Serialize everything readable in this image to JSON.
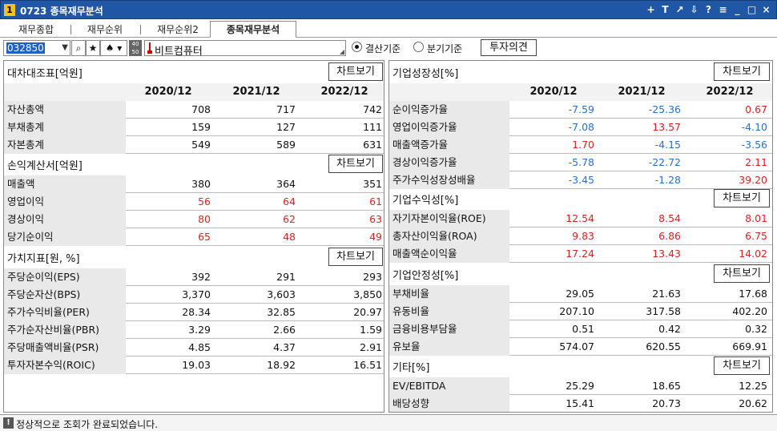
{
  "window": {
    "number": "1",
    "title": "0723 종목재무분석",
    "controls": [
      "+",
      "T",
      "↗",
      "⇩",
      "?",
      "≡",
      "_",
      "□",
      "×"
    ]
  },
  "tabs": [
    "재무종합",
    "재무순위",
    "재무순위2",
    "종목재무분석"
  ],
  "toolbar": {
    "code": "032850",
    "tool_label_top": "40",
    "tool_label_bottom": "50",
    "stock_name": "비트컴퓨터",
    "radio1": "결산기준",
    "radio2": "분기기준",
    "opinion_button": "투자의견"
  },
  "chart_button": "차트보기",
  "years": [
    "2020/12",
    "2021/12",
    "2022/12"
  ],
  "left": {
    "balance": {
      "title": "대차대조표[억원]",
      "rows": [
        {
          "label": "자산총액",
          "values": [
            "708",
            "717",
            "742"
          ],
          "color": "black"
        },
        {
          "label": "부채총계",
          "values": [
            "159",
            "127",
            "111"
          ],
          "color": "black"
        },
        {
          "label": "자본총계",
          "values": [
            "549",
            "589",
            "631"
          ],
          "color": "black"
        }
      ]
    },
    "income": {
      "title": "손익계산서[억원]",
      "rows": [
        {
          "label": "매출액",
          "values": [
            "380",
            "364",
            "351"
          ],
          "color": "black"
        },
        {
          "label": "영업이익",
          "values": [
            "56",
            "64",
            "61"
          ],
          "color": "red"
        },
        {
          "label": "경상이익",
          "values": [
            "80",
            "62",
            "63"
          ],
          "color": "red"
        },
        {
          "label": "당기순이익",
          "values": [
            "65",
            "48",
            "49"
          ],
          "color": "red"
        }
      ]
    },
    "value": {
      "title": "가치지표[원, %]",
      "rows": [
        {
          "label": "주당순이익(EPS)",
          "values": [
            "392",
            "291",
            "293"
          ],
          "color": "black"
        },
        {
          "label": "주당순자산(BPS)",
          "values": [
            "3,370",
            "3,603",
            "3,850"
          ],
          "color": "black"
        },
        {
          "label": "주가수익비율(PER)",
          "values": [
            "28.34",
            "32.85",
            "20.97"
          ],
          "color": "black"
        },
        {
          "label": "주가순자산비율(PBR)",
          "values": [
            "3.29",
            "2.66",
            "1.59"
          ],
          "color": "black"
        },
        {
          "label": "주당매출액비율(PSR)",
          "values": [
            "4.85",
            "4.37",
            "2.91"
          ],
          "color": "black"
        },
        {
          "label": "투자자본수익(ROIC)",
          "values": [
            "19.03",
            "18.92",
            "16.51"
          ],
          "color": "black"
        }
      ]
    }
  },
  "right": {
    "growth": {
      "title": "기업성장성[%]",
      "rows": [
        {
          "label": "순이익증가율",
          "values": [
            "-7.59",
            "-25.36",
            "0.67"
          ],
          "colors": [
            "blue",
            "blue",
            "red"
          ]
        },
        {
          "label": "영업이익증가율",
          "values": [
            "-7.08",
            "13.57",
            "-4.10"
          ],
          "colors": [
            "blue",
            "red",
            "blue"
          ]
        },
        {
          "label": "매출액증가율",
          "values": [
            "1.70",
            "-4.15",
            "-3.56"
          ],
          "colors": [
            "red",
            "blue",
            "blue"
          ]
        },
        {
          "label": "경상이익증가율",
          "values": [
            "-5.78",
            "-22.72",
            "2.11"
          ],
          "colors": [
            "blue",
            "blue",
            "red"
          ]
        },
        {
          "label": "주가수익성장성배율",
          "values": [
            "-3.45",
            "-1.28",
            "39.20"
          ],
          "colors": [
            "blue",
            "blue",
            "red"
          ]
        }
      ]
    },
    "profit": {
      "title": "기업수익성[%]",
      "rows": [
        {
          "label": "자기자본이익율(ROE)",
          "values": [
            "12.54",
            "8.54",
            "8.01"
          ],
          "colors": [
            "red",
            "red",
            "red"
          ]
        },
        {
          "label": "총자산이익율(ROA)",
          "values": [
            "9.83",
            "6.86",
            "6.75"
          ],
          "colors": [
            "red",
            "red",
            "red"
          ]
        },
        {
          "label": "매출액순이익율",
          "values": [
            "17.24",
            "13.43",
            "14.02"
          ],
          "colors": [
            "red",
            "red",
            "red"
          ]
        }
      ]
    },
    "stability": {
      "title": "기업안정성[%]",
      "rows": [
        {
          "label": "부채비율",
          "values": [
            "29.05",
            "21.63",
            "17.68"
          ],
          "colors": [
            "black",
            "black",
            "black"
          ]
        },
        {
          "label": "유동비율",
          "values": [
            "207.10",
            "317.58",
            "402.20"
          ],
          "colors": [
            "black",
            "black",
            "black"
          ]
        },
        {
          "label": "금융비용부담율",
          "values": [
            "0.51",
            "0.42",
            "0.32"
          ],
          "colors": [
            "black",
            "black",
            "black"
          ]
        },
        {
          "label": "유보율",
          "values": [
            "574.07",
            "620.55",
            "669.91"
          ],
          "colors": [
            "black",
            "black",
            "black"
          ]
        }
      ]
    },
    "etc": {
      "title": "기타[%]",
      "rows": [
        {
          "label": "EV/EBITDA",
          "values": [
            "25.29",
            "18.65",
            "12.25"
          ],
          "colors": [
            "black",
            "black",
            "black"
          ]
        },
        {
          "label": "배당성향",
          "values": [
            "15.41",
            "20.73",
            "20.62"
          ],
          "colors": [
            "black",
            "black",
            "black"
          ]
        }
      ]
    }
  },
  "status": {
    "icon": "!",
    "message": "정상적으로 조회가 완료되었습니다."
  }
}
